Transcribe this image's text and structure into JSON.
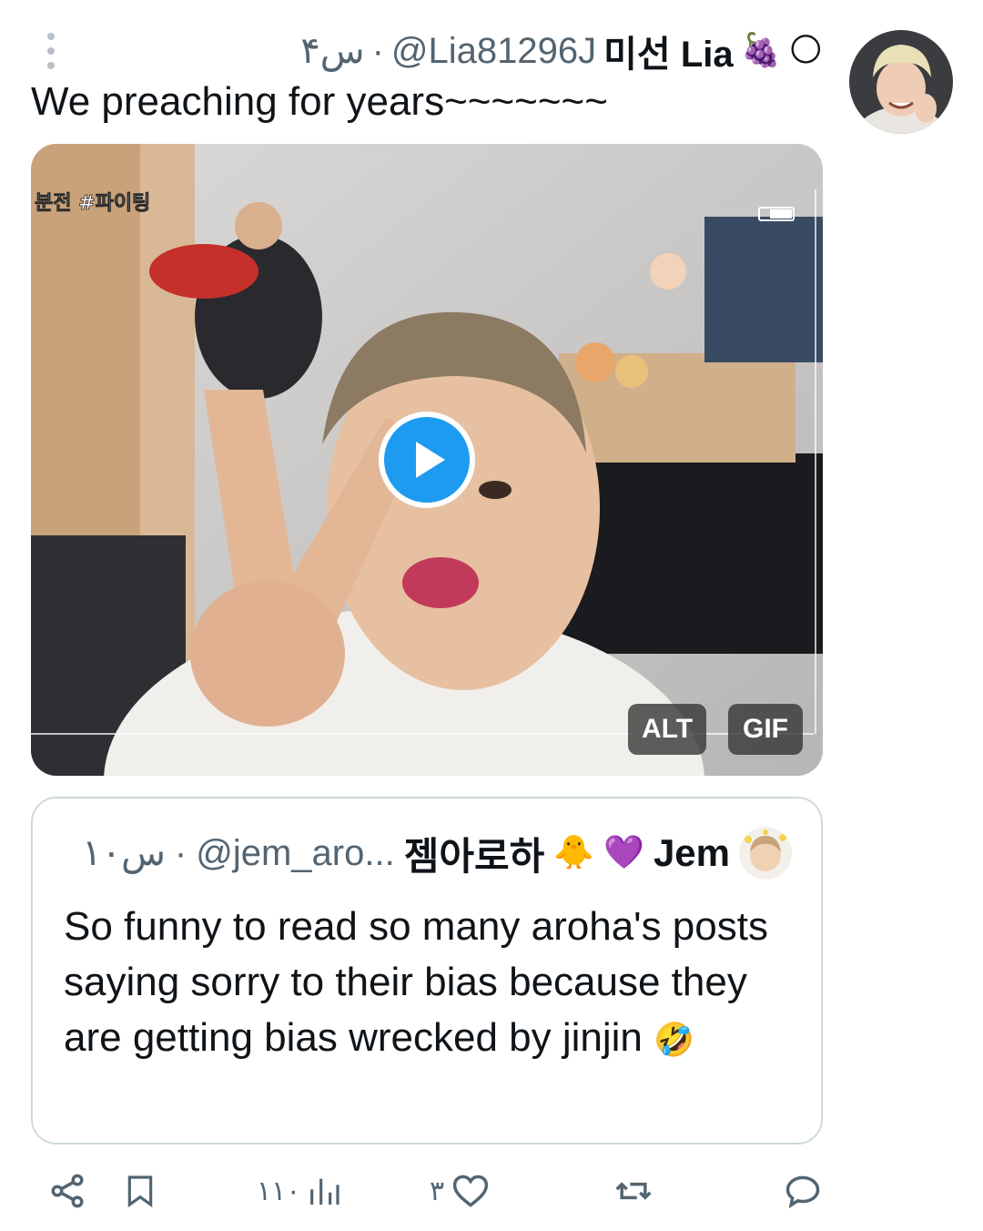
{
  "tweet": {
    "time": "۴س",
    "separator": "·",
    "handle": "@Lia81296J",
    "display_name": "미선 Lia",
    "name_emoji_1": "🍇",
    "name_emoji_2": "🌕",
    "text": "We preaching for years~~~~~~~"
  },
  "media": {
    "type": "GIF",
    "alt_label": "ALT",
    "gif_label": "GIF",
    "overlay_text": "분전 #파이팅"
  },
  "quote": {
    "time": "۱۰س",
    "separator": "·",
    "handle": "@jem_aro...",
    "display_name_korean": "젬아로하",
    "emoji_1": "🐥",
    "emoji_2": "💜",
    "display_name": "Jem",
    "text": "So funny to read so many aroha's posts saying sorry to their bias because they are getting bias wrecked by jinjin",
    "text_emoji": "🤣"
  },
  "actions": {
    "views": "۱۱۰",
    "likes": "۳",
    "reposts": "",
    "replies": ""
  },
  "icons": [
    "more-vertical-icon",
    "share-icon",
    "bookmark-icon",
    "views-icon",
    "heart-icon",
    "repost-icon",
    "reply-icon",
    "play-icon"
  ],
  "colors": {
    "accent": "#1d9bf0",
    "text": "#0f1419",
    "secondary_text": "#536471",
    "border": "#cfd9de"
  }
}
